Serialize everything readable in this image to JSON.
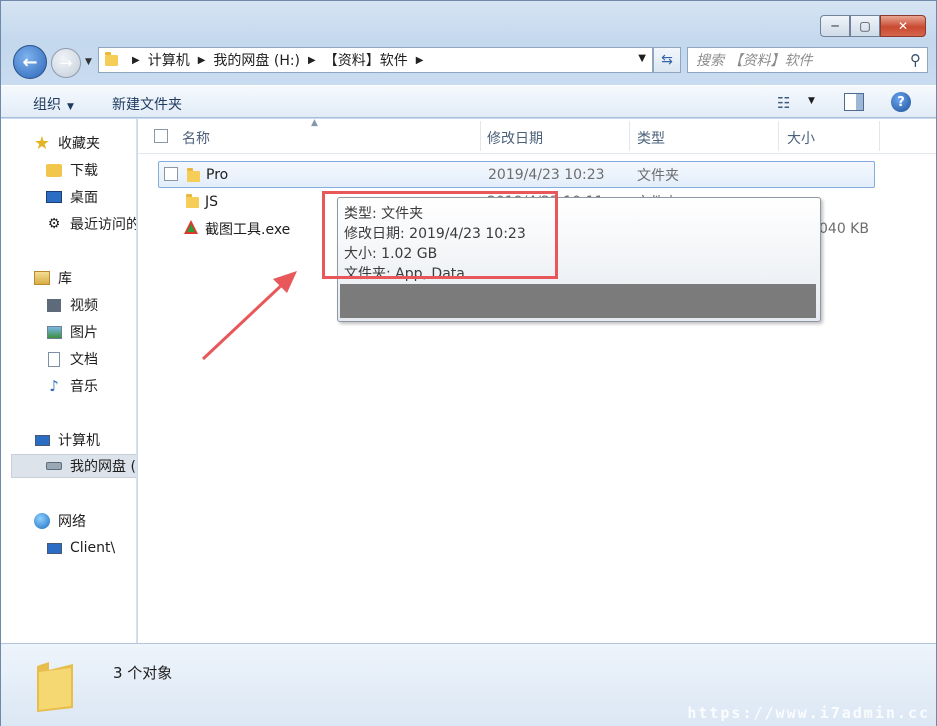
{
  "window": {
    "minimize": "─",
    "maximize": "▢",
    "close": "✕"
  },
  "address": {
    "crumbs": [
      "计算机",
      "我的网盘 (H:)",
      "【资料】软件"
    ]
  },
  "search": {
    "placeholder": "搜索 【资料】软件"
  },
  "toolbar": {
    "organize": "组织",
    "new_folder": "新建文件夹"
  },
  "nav": {
    "favorites": "收藏夹",
    "downloads": "下载",
    "desktop": "桌面",
    "recent": "最近访问的",
    "libraries": "库",
    "videos": "视频",
    "pictures": "图片",
    "documents": "文档",
    "music": "音乐",
    "computer": "计算机",
    "mydrive": "我的网盘 (",
    "network": "网络",
    "client": "Client\\"
  },
  "columns": {
    "name": "名称",
    "modified": "修改日期",
    "type": "类型",
    "size": "大小"
  },
  "files": [
    {
      "name": "Pro",
      "modified": "2019/4/23 10:23",
      "type": "文件夹",
      "size": ""
    },
    {
      "name": "JS",
      "modified": "2019/4/23 10:11",
      "type": "文件夹",
      "size": ""
    },
    {
      "name": "截图工具.exe",
      "modified": "",
      "type": "",
      "size": "040 KB"
    }
  ],
  "tooltip": {
    "type": "类型: 文件夹",
    "modified": "修改日期: 2019/4/23 10:23",
    "size": "大小: 1.02 GB",
    "folders": "文件夹: App, Data"
  },
  "status": {
    "count": "3 个对象"
  },
  "watermark": "https://www.i7admin.cc",
  "colors": {
    "highlight_box": "#e8575a",
    "selection": "#84acdd"
  }
}
